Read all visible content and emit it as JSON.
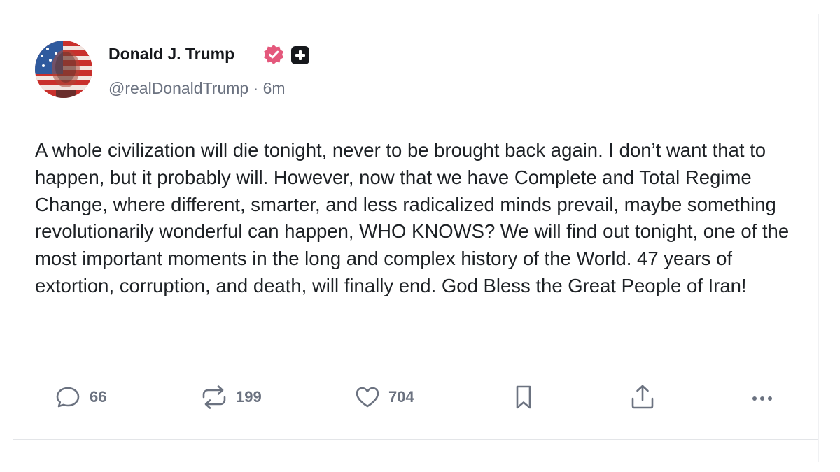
{
  "post": {
    "author": {
      "display_name": "Donald J. Trump",
      "handle": "@realDonaldTrump",
      "separator": "·",
      "time_ago": "6m",
      "verified_color": "#e4587c",
      "avatar_icon": "flag-portrait-avatar"
    },
    "body": "A whole civilization will die tonight, never to be brought back again. I don’t want that to happen, but it probably will. However, now that we have Complete and Total Regime Change, where different, smarter, and less radicalized minds prevail, maybe something revolutionarily wonderful can happen, WHO KNOWS? We will find out tonight, one of the most important moments in the long and complex history of the World. 47 years of extortion, corruption, and death, will finally end. God Bless the Great People of Iran!",
    "actions": {
      "replies": "66",
      "reposts": "199",
      "likes": "704"
    }
  }
}
